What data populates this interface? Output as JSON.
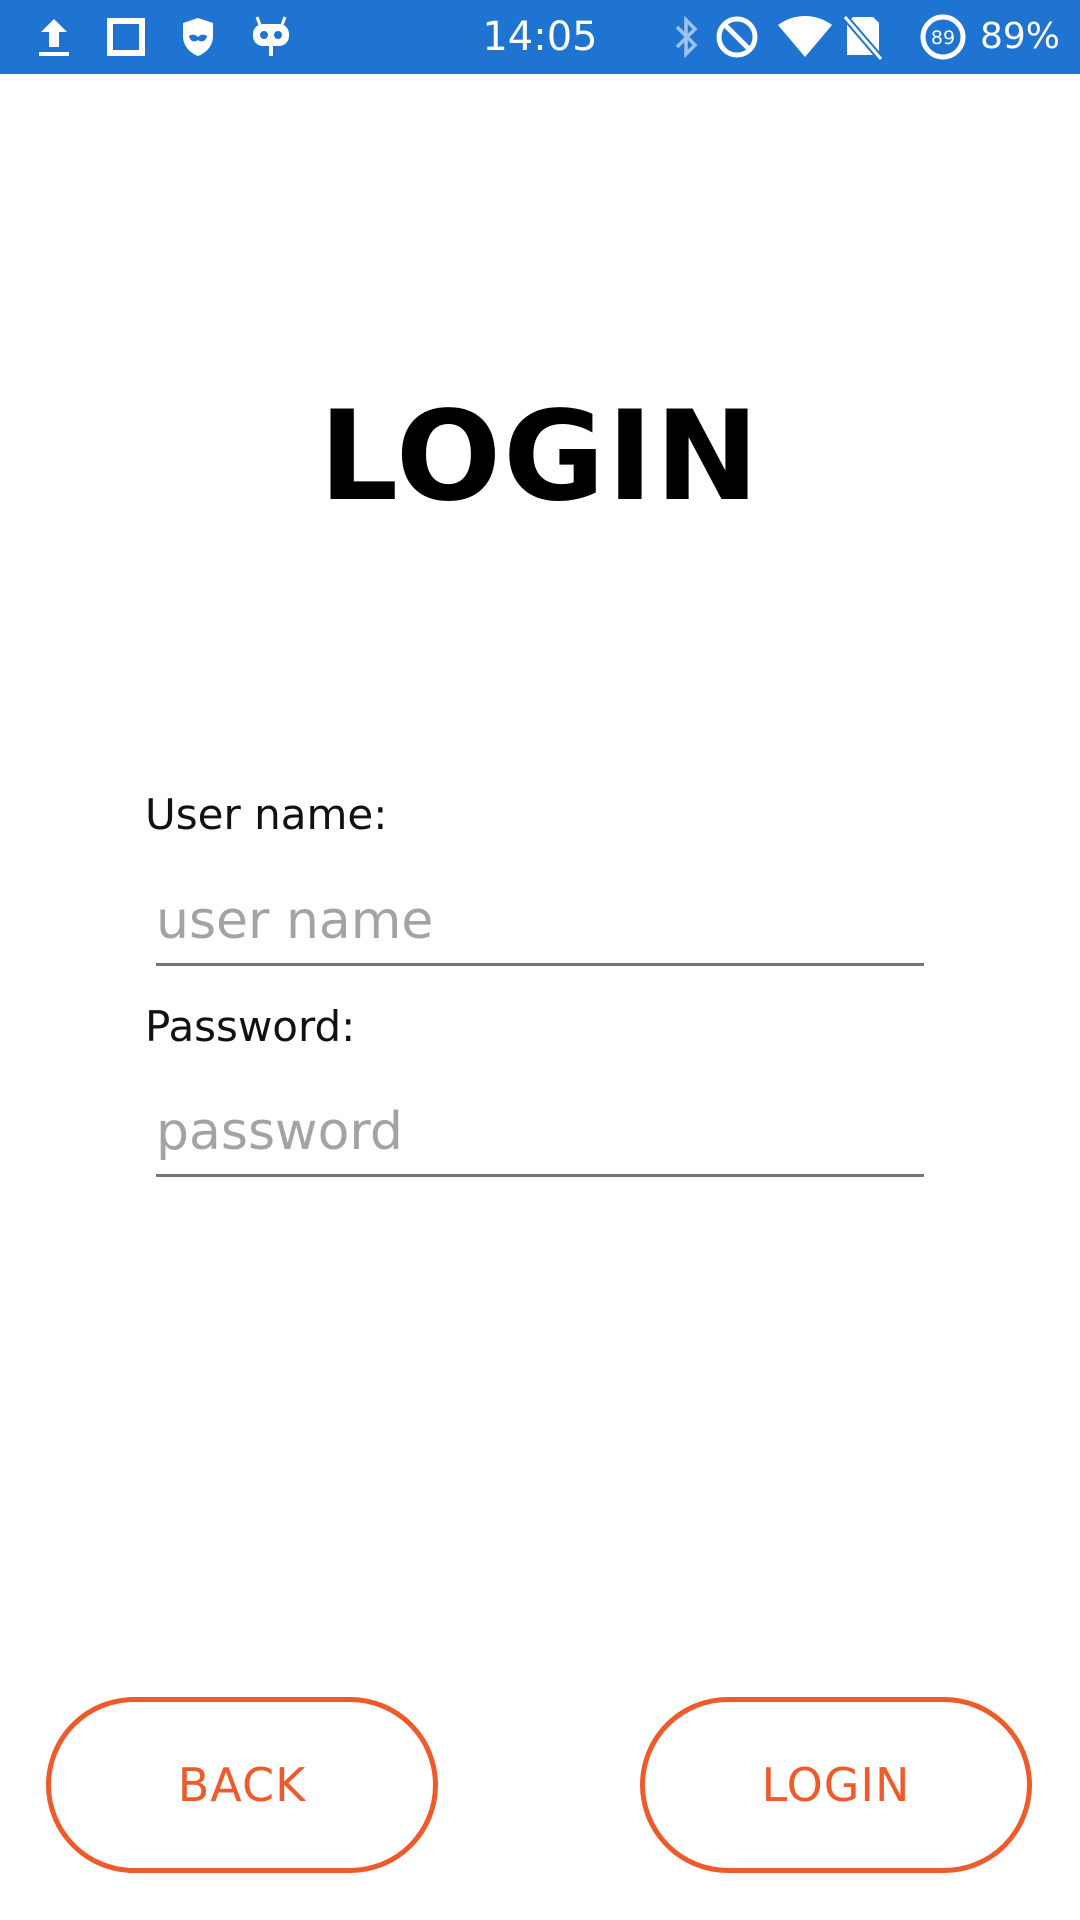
{
  "status_bar": {
    "time": "14:05",
    "battery_badge": "89",
    "battery_percent": "89%",
    "background_color": "#1f74d2",
    "left_icons": [
      "upload-icon",
      "square-icon",
      "shield-icon",
      "robot-icon"
    ],
    "right_icons": [
      "bluetooth-icon",
      "do-not-disturb-icon",
      "wifi-icon",
      "no-sim-icon",
      "battery-circle-icon"
    ]
  },
  "login": {
    "title": "LOGIN",
    "username_label": "User name:",
    "username_placeholder": "user name",
    "password_label": "Password:",
    "password_placeholder": "password"
  },
  "buttons": {
    "back_label": "BACK",
    "login_label": "LOGIN",
    "accent_color": "#ee5a2a"
  }
}
